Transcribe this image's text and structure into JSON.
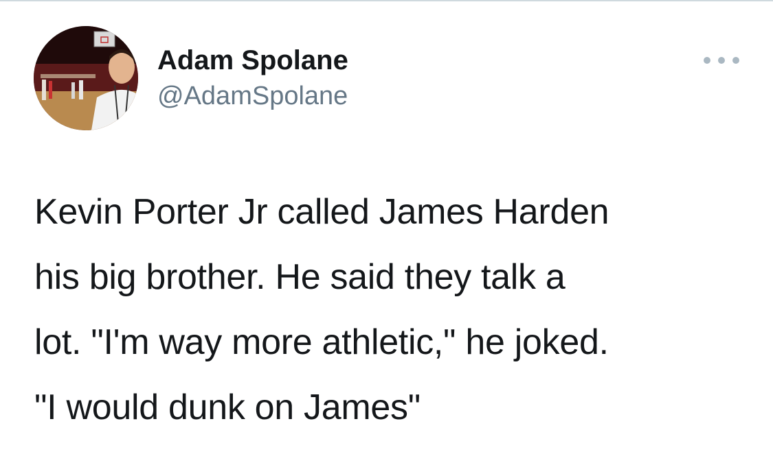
{
  "tweet": {
    "author": {
      "display_name": "Adam Spolane",
      "handle": "@AdamSpolane",
      "avatar_icon": "profile-photo-avatar"
    },
    "more_icon": "ellipsis-icon",
    "text": "Kevin Porter Jr called James Harden\nhis big brother. He said they talk a\nlot. \"I'm way more athletic,\" he joked.\n\"I would dunk on James\""
  },
  "colors": {
    "text_primary": "#14171a",
    "text_secondary": "#657786",
    "icon_muted": "#aab8c2",
    "background": "#ffffff"
  }
}
